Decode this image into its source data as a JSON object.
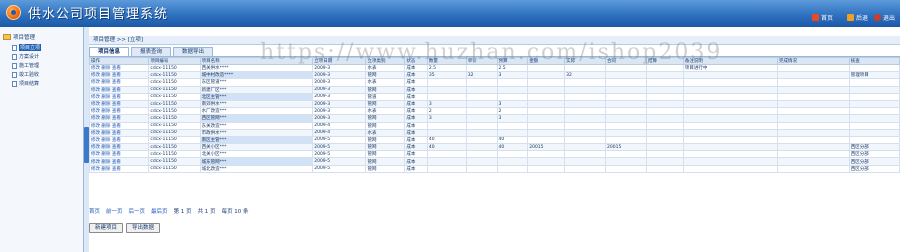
{
  "header": {
    "title": "供水公司项目管理系统",
    "home": "首页",
    "back": "后退",
    "exit": "退出"
  },
  "sidebar": {
    "root": "项目管理",
    "items": [
      {
        "label": "项目立项"
      },
      {
        "label": "方案设计"
      },
      {
        "label": "施工管理"
      },
      {
        "label": "竣工验收"
      },
      {
        "label": "项目结算"
      }
    ]
  },
  "breadcrumb": "项目管理 >> [立项]",
  "tabs": [
    "项目信息",
    "报表查询",
    "数据导出"
  ],
  "grid": {
    "headers": [
      "操作",
      "项目编号",
      "项目名称",
      "立项日期",
      "立项类别",
      "状态",
      "数量",
      "单价",
      "预算",
      "金额",
      "实际",
      "合同",
      "结算",
      "备注说明",
      "完成情况",
      "核查"
    ],
    "rows": [
      [
        "修改 删除 查看",
        "cdcx-11150",
        "西关供水****",
        "2009-3",
        "水表",
        "成本",
        "2.5",
        "",
        "2.5",
        "",
        "",
        "",
        "",
        "项目进行中",
        "",
        ""
      ],
      [
        "修改 删除 查看",
        "cdcx-11150",
        "城中村改造****",
        "2009-3",
        "管网",
        "成本",
        "35",
        "32",
        "3",
        "",
        "32",
        "",
        "",
        "",
        "",
        "管理项目"
      ],
      [
        "修改 删除 查看",
        "cdcx-11150",
        "东区管道***",
        "2009-3",
        "水表",
        "成本",
        "",
        "",
        "",
        "",
        "",
        "",
        "",
        "",
        "",
        ""
      ],
      [
        "修改 删除 查看",
        "cdcx-11150",
        "新建厂区***",
        "2009-3",
        "管网",
        "成本",
        "",
        "",
        "",
        "",
        "",
        "",
        "",
        "",
        "",
        ""
      ],
      [
        "修改 删除 查看",
        "cdcx-11150",
        "北区主管***",
        "2009-3",
        "管道",
        "成本",
        "",
        "",
        "",
        "",
        "",
        "",
        "",
        "",
        "",
        ""
      ],
      [
        "修改 删除 查看",
        "cdcx-11150",
        "南郊供水***",
        "2009-3",
        "管网",
        "成本",
        "3",
        "",
        "3",
        "",
        "",
        "",
        "",
        "",
        "",
        ""
      ],
      [
        "修改 删除 查看",
        "cdcx-11150",
        "水厂改造***",
        "2009-3",
        "水表",
        "成本",
        "2",
        "",
        "2",
        "",
        "",
        "",
        "",
        "",
        "",
        ""
      ],
      [
        "修改 删除 查看",
        "cdcx-11150",
        "西区管网***",
        "2009-3",
        "管网",
        "成本",
        "3",
        "",
        "3",
        "",
        "",
        "",
        "",
        "",
        "",
        ""
      ],
      [
        "修改 删除 查看",
        "cdcx-11150",
        "东关改造***",
        "2009-4",
        "管网",
        "成本",
        "",
        "",
        "",
        "",
        "",
        "",
        "",
        "",
        "",
        ""
      ],
      [
        "修改 删除 查看",
        "cdcx-11150",
        "市政供水***",
        "2009-4",
        "水表",
        "成本",
        "",
        "",
        "",
        "",
        "",
        "",
        "",
        "",
        "",
        ""
      ],
      [
        "修改 删除 查看",
        "cdcx-11150",
        "南区主管***",
        "2009-5",
        "管网",
        "成本",
        "40",
        "",
        "40",
        "",
        "",
        "",
        "",
        "",
        "",
        ""
      ],
      [
        "修改 删除 查看",
        "cdcx-11150",
        "西关小区***",
        "2009-5",
        "管网",
        "成本",
        "40",
        "",
        "40",
        "20015",
        "",
        "20015",
        "",
        "",
        "",
        "西区分部"
      ],
      [
        "修改 删除 查看",
        "cdcx-11150",
        "北关小区***",
        "2009-5",
        "管网",
        "成本",
        "",
        "",
        "",
        "",
        "",
        "",
        "",
        "",
        "",
        "西区分部"
      ],
      [
        "修改 删除 查看",
        "cdcx-11150",
        "城东管网***",
        "2009-5",
        "管网",
        "成本",
        "",
        "",
        "",
        "",
        "",
        "",
        "",
        "",
        "",
        "西区分部"
      ],
      [
        "修改 删除 查看",
        "cdcx-11150",
        "城北改造***",
        "2009-5",
        "管网",
        "成本",
        "",
        "",
        "",
        "",
        "",
        "",
        "",
        "",
        "",
        "西区分部"
      ]
    ]
  },
  "pager": {
    "first": "首页",
    "prev": "前一页",
    "next": "后一页",
    "last": "最后页",
    "page": "第 1 页",
    "total": "共 1 页",
    "size": "每页 10 条"
  },
  "buttons": {
    "new": "新建项目",
    "export": "导出数据"
  },
  "watermark": "https://www.huzhan.com/ishop2039",
  "colors": {
    "header": "#2f72c0",
    "sidebar_bg": "#f4f8fd",
    "grid_header": "#dae6f4",
    "link": "#1f57b5"
  }
}
